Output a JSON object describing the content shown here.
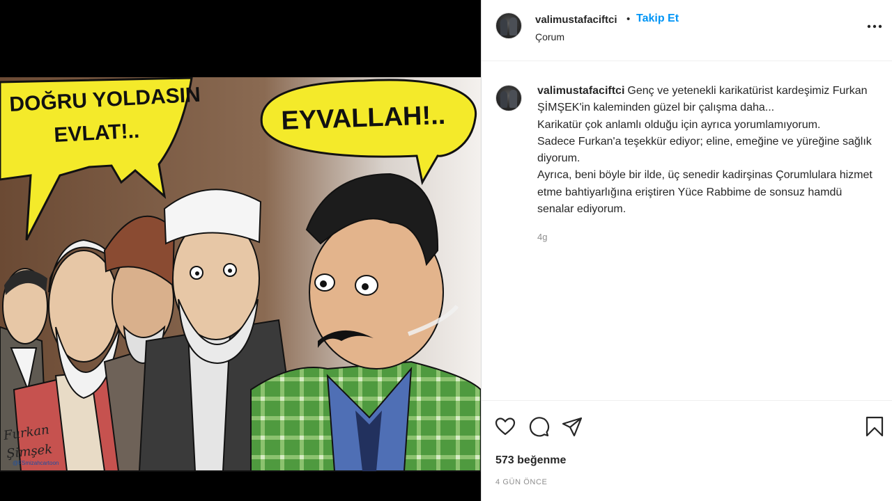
{
  "colors": {
    "link": "#0095f6",
    "text": "#262626",
    "muted": "#8e8e8e",
    "bubble": "#f4ea2a"
  },
  "post": {
    "media": {
      "bubble_left_line1": "DOĞRU YOLDASIN",
      "bubble_left_line2": "EVLAT!..",
      "bubble_right": "EYVALLAH!..",
      "signature_line1": "Furkan",
      "signature_line2": "Şimşek",
      "signature_handle": "@FSmizahcartoon"
    },
    "header": {
      "username": "valimustafaciftci",
      "dot": "•",
      "follow_label": "Takip Et",
      "location": "Çorum",
      "more_icon": "more-horizontal-icon"
    },
    "caption": {
      "username": "valimustafaciftci",
      "lines": [
        "Genç ve yetenekli karikatürist kardeşimiz Furkan",
        "ŞİMŞEK'in kaleminden güzel bir çalışma daha...",
        "Karikatür çok anlamlı olduğu için ayrıca yorumlamıyorum.",
        "Sadece Furkan'a teşekkür ediyor; eline, emeğine ve yüreğine sağlık",
        "diyorum.",
        "Ayrıca, beni böyle bir ilde, üç senedir kadirşinas Çorumlulara hizmet",
        "etme bahtiyarlığına eriştiren Yüce Rabbime de sonsuz hamdü",
        "senalar ediyorum."
      ],
      "age": "4g"
    },
    "actions": {
      "icons": [
        "heart-icon",
        "comment-icon",
        "share-icon",
        "bookmark-icon"
      ],
      "likes": "573 beğenme",
      "date": "4 GÜN ÖNCE"
    }
  }
}
